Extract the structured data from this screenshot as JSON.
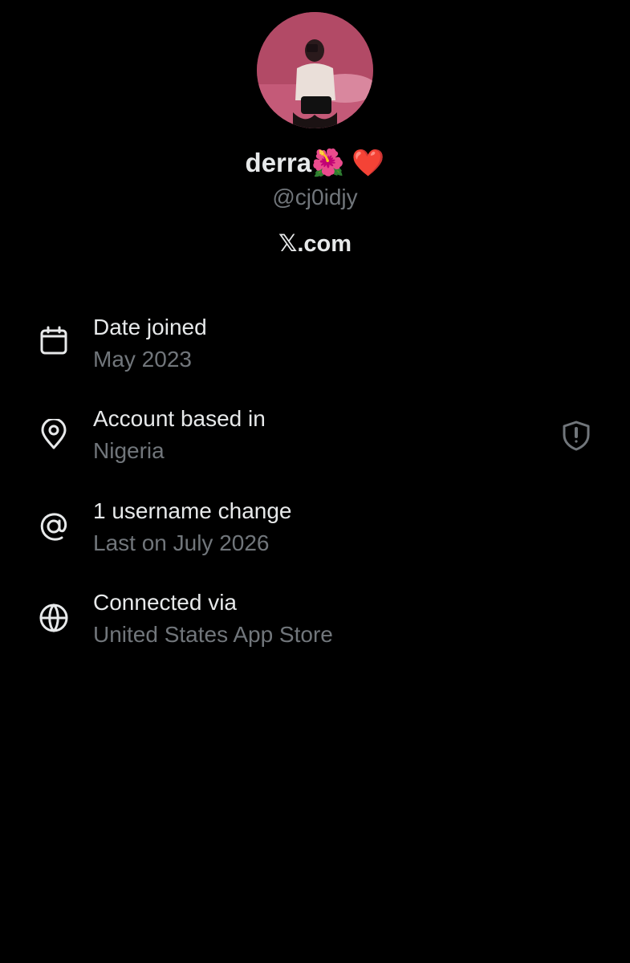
{
  "profile": {
    "display_name": "derra🌺 ❤️",
    "handle": "@cj0idjy",
    "site": "𝕏.com"
  },
  "about": {
    "rows": [
      {
        "icon": "calendar-icon",
        "title": "Date joined",
        "value": "May 2023"
      },
      {
        "icon": "location-pin-icon",
        "title": "Account based in",
        "value": "Nigeria",
        "badge_icon": "shield-alert-icon"
      },
      {
        "icon": "at-sign-icon",
        "title": "1 username change",
        "value": "Last on July 2026"
      },
      {
        "icon": "globe-icon",
        "title": "Connected via",
        "value": "United States App Store"
      }
    ]
  },
  "colors": {
    "background": "#000000",
    "primary_text": "#e7e9ea",
    "secondary_text": "#71767b"
  }
}
